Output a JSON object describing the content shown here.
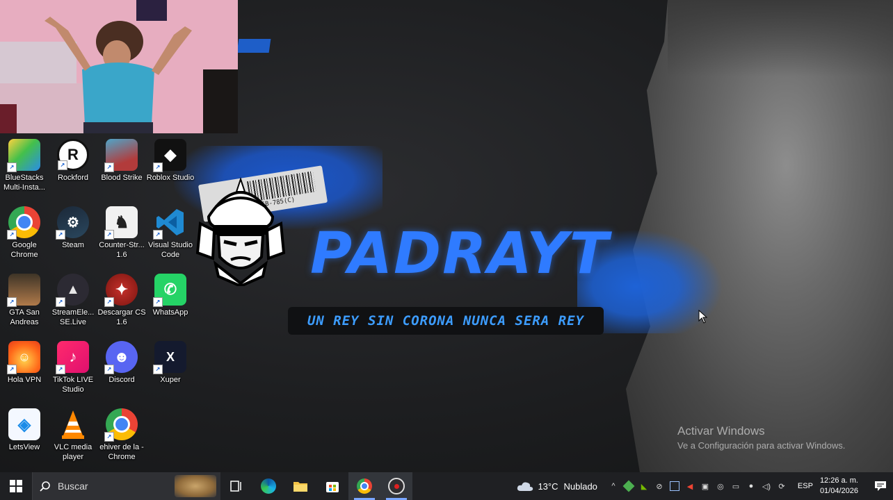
{
  "wallpaper": {
    "title": "PADRAYT",
    "slogan": "UN REY SIN CORONA NUNCA SERA REY",
    "barcode_text": "56B-785(C)",
    "activation_title": "Activar Windows",
    "activation_subtitle": "Ve a Configuración para activar Windows."
  },
  "desktop_icons": [
    {
      "label": "BlueStacks Multi-Insta...",
      "icon": "bluestacks-icon"
    },
    {
      "label": "Rockford",
      "icon": "rockford-icon"
    },
    {
      "label": "Blood Strike",
      "icon": "blood-strike-icon"
    },
    {
      "label": "Roblox Studio",
      "icon": "roblox-studio-icon"
    },
    {
      "label": "Google Chrome",
      "icon": "chrome-icon"
    },
    {
      "label": "Steam",
      "icon": "steam-icon"
    },
    {
      "label": "Counter-Str... 1.6",
      "icon": "counter-strike-icon"
    },
    {
      "label": "Visual Studio Code",
      "icon": "vscode-icon"
    },
    {
      "label": "GTA San Andreas",
      "icon": "gta-icon"
    },
    {
      "label": "StreamEle... SE.Live",
      "icon": "streamelements-icon"
    },
    {
      "label": "Descargar CS 1.6",
      "icon": "cs-download-icon"
    },
    {
      "label": "WhatsApp",
      "icon": "whatsapp-icon"
    },
    {
      "label": "Hola VPN",
      "icon": "hola-vpn-icon"
    },
    {
      "label": "TikTok LIVE Studio",
      "icon": "tiktok-live-icon"
    },
    {
      "label": "Discord",
      "icon": "discord-icon"
    },
    {
      "label": "Xuper",
      "icon": "xuper-icon"
    },
    {
      "label": "LetsView",
      "icon": "letsview-icon"
    },
    {
      "label": "VLC media player",
      "icon": "vlc-icon"
    },
    {
      "label": "ehiver de la - Chrome",
      "icon": "chrome-icon"
    }
  ],
  "taskbar": {
    "search_placeholder": "Buscar",
    "weather_temp": "13°C",
    "weather_condition": "Nublado",
    "language": "ESP",
    "time": "12:26 a. m.",
    "date": "01/04/2026",
    "apps": [
      "task-view-icon",
      "edge-icon",
      "file-explorer-icon",
      "store-icon",
      "chrome-icon",
      "obs-icon"
    ]
  },
  "colors": {
    "accent_blue": "#2f7bff",
    "slogan_blue": "#3d9dff",
    "taskbar": "#1f2023"
  }
}
